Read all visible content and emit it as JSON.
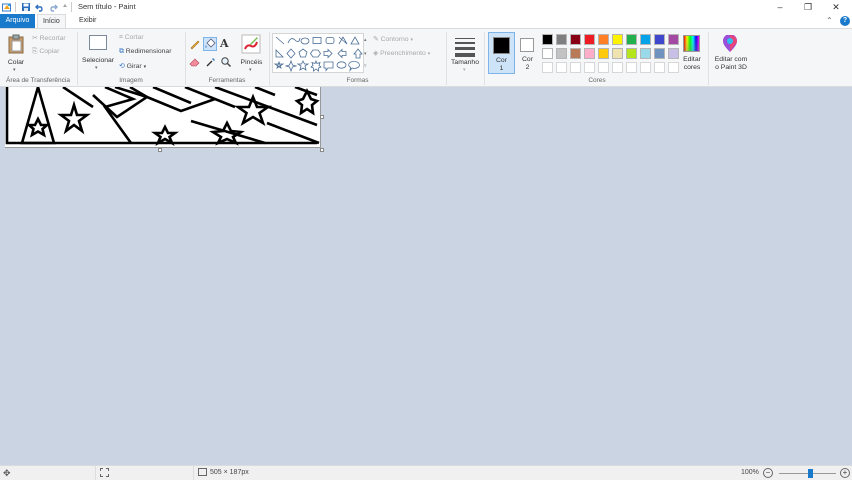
{
  "window": {
    "title": "Sem título - Paint",
    "minimize": "–",
    "restore": "❐",
    "close": "✕",
    "collapse_ribbon": "⌃",
    "help": "?"
  },
  "tabs": [
    {
      "label": "Arquivo"
    },
    {
      "label": "Início"
    },
    {
      "label": "Exibir"
    }
  ],
  "groups": {
    "clipboard": {
      "label": "Área de Transferência",
      "paste": "Colar",
      "cut": "Recortar",
      "copy": "Copiar"
    },
    "image": {
      "label": "Imagem",
      "select": "Selecionar",
      "crop": "Cortar",
      "resize": "Redimensionar",
      "rotate": "Girar"
    },
    "tools": {
      "label": "Ferramentas",
      "brushes": "Pincéis"
    },
    "shapes": {
      "label": "Formas",
      "outline": "Contorno",
      "fill": "Preenchimento"
    },
    "size": {
      "label": "Tamanho"
    },
    "colors": {
      "label": "Cores",
      "color1": "Cor\n1",
      "color2": "Cor\n2",
      "color1_line1": "Cor",
      "color1_line2": "1",
      "color2_line1": "Cor",
      "color2_line2": "2",
      "edit_line1": "Editar",
      "edit_line2": "cores",
      "paint3d_line1": "Editar com",
      "paint3d_line2": "o Paint 3D",
      "palette_row1": [
        "#000000",
        "#7f7f7f",
        "#880015",
        "#ed1c24",
        "#ff7f27",
        "#fff200",
        "#22b14c",
        "#00a2e8",
        "#3f48cc",
        "#a349a4"
      ],
      "palette_row2": [
        "#ffffff",
        "#c3c3c3",
        "#b97a57",
        "#ffaec9",
        "#ffc90e",
        "#efe4b0",
        "#b5e61d",
        "#99d9ea",
        "#7092be",
        "#c8bfe7"
      ],
      "primary": "#000000",
      "secondary": "#ffffff"
    }
  },
  "status": {
    "image_size": "505 × 187px",
    "zoom": "100%",
    "zoom_level": 0.55
  },
  "accent": "#1979ca",
  "background": "#cbd4e2"
}
